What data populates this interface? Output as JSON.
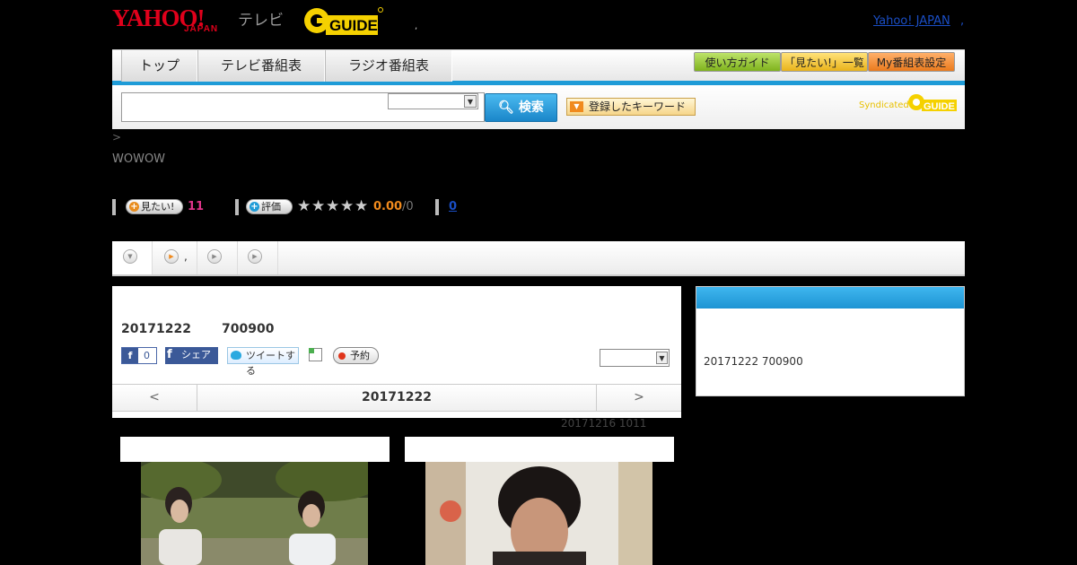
{
  "header": {
    "logo_yahoo": "YAHOO!",
    "logo_japan": "JAPAN",
    "logo_tv": "テレビ",
    "logo_gguide": "G GUIDE",
    "dot": ",",
    "yahoo_japan_link": "Yahoo! JAPAN",
    "link_dot": ","
  },
  "nav": {
    "tabs": [
      "トップ",
      "テレビ番組表",
      "ラジオ番組表"
    ],
    "buttons": [
      "使い方ガイド",
      "「見たい!」一覧",
      "My番組表設定"
    ]
  },
  "search": {
    "input_value": "",
    "select_value": "",
    "button_label": "検索",
    "keyword_label": "登録したキーワード",
    "syndicated": "Syndicated",
    "syndicated_logo": "G GUIDE"
  },
  "breadcrumb": " >",
  "channel": "WOWOW",
  "rating": {
    "want_label": "見たい!",
    "want_count": "11",
    "rate_label": "評価",
    "stars": "★",
    "score": "0.00",
    "out_of": "/0",
    "review_count": "0"
  },
  "subtabs": {
    "second_label": ","
  },
  "program": {
    "date": "20171222",
    "time": "700900",
    "fb_like_count": "0",
    "fb_share": "シェア",
    "tweet": "ツイートする",
    "reserve": "予約",
    "select_value": ""
  },
  "date_nav": {
    "prev": "<",
    "current": "20171222",
    "next": ">"
  },
  "updated_note": "20171216  1011",
  "side": {
    "text": "20171222  700900"
  },
  "colors": {
    "accent_blue": "#1e9bd7",
    "yahoo_red": "#e0001b",
    "gguide_yellow": "#f5d100",
    "want_pink": "#e0348a",
    "rating_orange": "#f08a1d"
  }
}
